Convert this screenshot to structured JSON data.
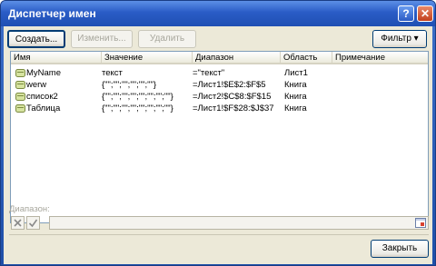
{
  "window": {
    "title": "Диспетчер имен"
  },
  "titlebar_buttons": {
    "help": "?",
    "close": "✕"
  },
  "toolbar": {
    "create_label": "Создать...",
    "edit_label": "Изменить...",
    "delete_label": "Удалить",
    "filter_label": "Фильтр ▾"
  },
  "table": {
    "columns": [
      "Имя",
      "Значение",
      "Диапазон",
      "Область",
      "Примечание"
    ],
    "rows": [
      {
        "name": "MyName",
        "value": "текст",
        "range": "=\"текст\"",
        "scope": "Лист1",
        "comment": ""
      },
      {
        "name": "werw",
        "value": "{\"\";\"\";\"\";\"\";\"\";\"\"}",
        "range": "=Лист1!$E$2:$F$5",
        "scope": "Книга",
        "comment": ""
      },
      {
        "name": "список2",
        "value": "{\"\";\"\";\"\";\"\";\"\";\"\";\"\";\"\"}",
        "range": "=Лист2!$C$8:$F$15",
        "scope": "Книга",
        "comment": ""
      },
      {
        "name": "Таблица",
        "value": "{\"\";\"\";\"\";\"\";\"\";\"\";\"\";\"\"}",
        "range": "=Лист1!$F$28:$J$37",
        "scope": "Книга",
        "comment": ""
      }
    ]
  },
  "range_section": {
    "label": "Диапазон:",
    "value": ""
  },
  "footer": {
    "close_label": "Закрыть"
  },
  "colors": {
    "title_bar": "#2a5cc6",
    "dialog_bg": "#ece9d8",
    "list_border": "#7f9db9"
  }
}
